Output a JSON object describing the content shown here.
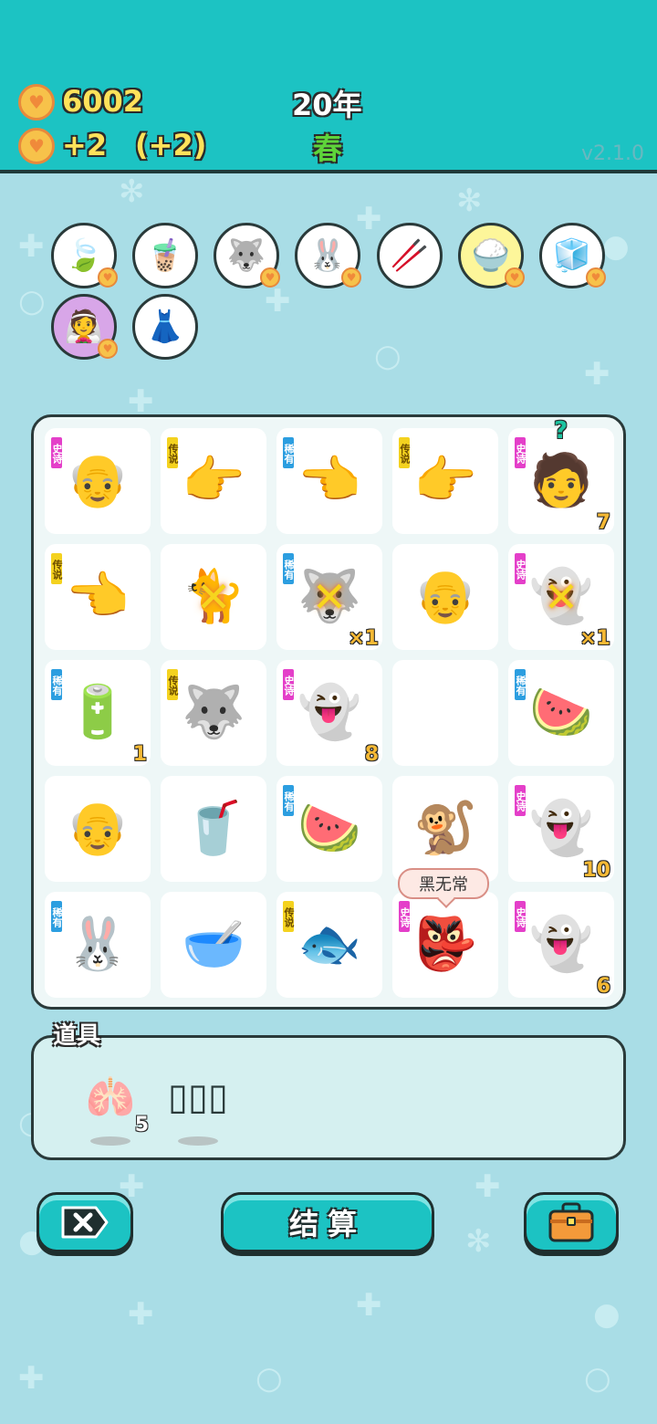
{
  "header": {
    "coins": "6002",
    "income": "+2",
    "income_bonus": "(+2)",
    "year": "20年",
    "season": "春",
    "version": "v2.1.0"
  },
  "collected_items": [
    {
      "name": "leaf",
      "icon": "leaf-icon",
      "glyph": "🍃",
      "bg": "#ffffff",
      "heart": true
    },
    {
      "name": "bubble-tea",
      "icon": "bubble-tea-icon",
      "glyph": "🧋",
      "bg": "#ffffff",
      "heart": false
    },
    {
      "name": "husky",
      "icon": "husky-icon",
      "glyph": "🐺",
      "bg": "#ffffff",
      "heart": true
    },
    {
      "name": "rabbit",
      "icon": "rabbit-icon",
      "glyph": "🐰",
      "bg": "#ffffff",
      "heart": true
    },
    {
      "name": "chopsticks",
      "icon": "chopsticks-icon",
      "glyph": "🥢",
      "bg": "#ffffff",
      "heart": false
    },
    {
      "name": "rice-bowl",
      "icon": "rice-bowl-icon",
      "glyph": "🍚",
      "bg": "#fdf69a",
      "heart": true
    },
    {
      "name": "sugar-cubes",
      "icon": "sugar-cubes-icon",
      "glyph": "🧊",
      "bg": "#ffffff",
      "heart": true
    },
    {
      "name": "wedding-couple",
      "icon": "wedding-couple-icon",
      "glyph": "👰",
      "bg": "#d8a6e8",
      "heart": true
    },
    {
      "name": "skirt",
      "icon": "skirt-icon",
      "glyph": "👗",
      "bg": "#ffffff",
      "heart": false
    }
  ],
  "board": [
    {
      "icon": "old-man-frown-icon",
      "glyph": "👴",
      "tag": "史诗",
      "tag_kind": "epic",
      "count": ""
    },
    {
      "icon": "pointing-hand-gold-icon",
      "glyph": "👉",
      "tag": "传说",
      "tag_kind": "legend",
      "count": ""
    },
    {
      "icon": "pointing-hand-brown-icon",
      "glyph": "👈",
      "tag": "稀有",
      "tag_kind": "rare",
      "count": ""
    },
    {
      "icon": "pointing-hand-gold-icon",
      "glyph": "👉",
      "tag": "传说",
      "tag_kind": "legend",
      "count": ""
    },
    {
      "icon": "masked-man-icon",
      "glyph": "🧑",
      "tag": "史诗",
      "tag_kind": "epic",
      "count": "7",
      "question": "?"
    },
    {
      "icon": "pointing-hand-left-icon",
      "glyph": "👈",
      "tag": "传说",
      "tag_kind": "legend",
      "count": ""
    },
    {
      "icon": "yellow-cat-icon",
      "glyph": "🐈",
      "tag": "",
      "tag_kind": "",
      "count": "",
      "crossed": true
    },
    {
      "icon": "husky-dog-icon",
      "glyph": "🐺",
      "tag": "稀有",
      "tag_kind": "rare",
      "count": "×1",
      "crossed": true
    },
    {
      "icon": "old-man-icon",
      "glyph": "👴",
      "tag": "",
      "tag_kind": "",
      "count": ""
    },
    {
      "icon": "ghost-outline-icon",
      "glyph": "👻",
      "tag": "史诗",
      "tag_kind": "epic",
      "count": "×1",
      "crossed": true
    },
    {
      "icon": "power-bank-icon",
      "glyph": "🔋",
      "tag": "稀有",
      "tag_kind": "rare",
      "count": "1"
    },
    {
      "icon": "husky-king-icon",
      "glyph": "🐺",
      "tag": "传说",
      "tag_kind": "legend",
      "count": ""
    },
    {
      "icon": "ghost-icon",
      "glyph": "👻",
      "tag": "史诗",
      "tag_kind": "epic",
      "count": "8"
    },
    {
      "icon": "empty-cell-icon",
      "glyph": "",
      "tag": "",
      "tag_kind": "",
      "count": ""
    },
    {
      "icon": "watermelon-icon",
      "glyph": "🍉",
      "tag": "稀有",
      "tag_kind": "rare",
      "count": ""
    },
    {
      "icon": "old-man-icon",
      "glyph": "👴",
      "tag": "",
      "tag_kind": "",
      "count": ""
    },
    {
      "icon": "soda-cup-icon",
      "glyph": "🥤",
      "tag": "",
      "tag_kind": "",
      "count": ""
    },
    {
      "icon": "watermelon-icon",
      "glyph": "🍉",
      "tag": "稀有",
      "tag_kind": "rare",
      "count": ""
    },
    {
      "icon": "monkey-icon",
      "glyph": "🐒",
      "tag": "",
      "tag_kind": "",
      "count": ""
    },
    {
      "icon": "ghost-icon",
      "glyph": "👻",
      "tag": "史诗",
      "tag_kind": "epic",
      "count": "10"
    },
    {
      "icon": "rabbit-red-icon",
      "glyph": "🐰",
      "tag": "稀有",
      "tag_kind": "rare",
      "count": ""
    },
    {
      "icon": "soup-bowl-icon",
      "glyph": "🥣",
      "tag": "",
      "tag_kind": "",
      "count": ""
    },
    {
      "icon": "koi-fish-icon",
      "glyph": "🐟",
      "tag": "传说",
      "tag_kind": "legend",
      "count": ""
    },
    {
      "icon": "black-white-impermanence-icon",
      "glyph": "👺",
      "tag": "史诗",
      "tag_kind": "epic",
      "count": ""
    },
    {
      "icon": "ghost-icon",
      "glyph": "👻",
      "tag": "史诗",
      "tag_kind": "epic",
      "count": "6"
    }
  ],
  "tooltip": "黑无常",
  "props": {
    "title": "道具",
    "items": [
      {
        "icon": "liver-icon",
        "glyph": "🫁",
        "count": "5"
      },
      {
        "icon": "empty-slots-icon",
        "glyph": "▯▯▯",
        "count": ""
      }
    ]
  },
  "buttons": {
    "close_icon": "close-tag-icon",
    "settle_label": "结算",
    "bag_icon": "briefcase-icon"
  }
}
